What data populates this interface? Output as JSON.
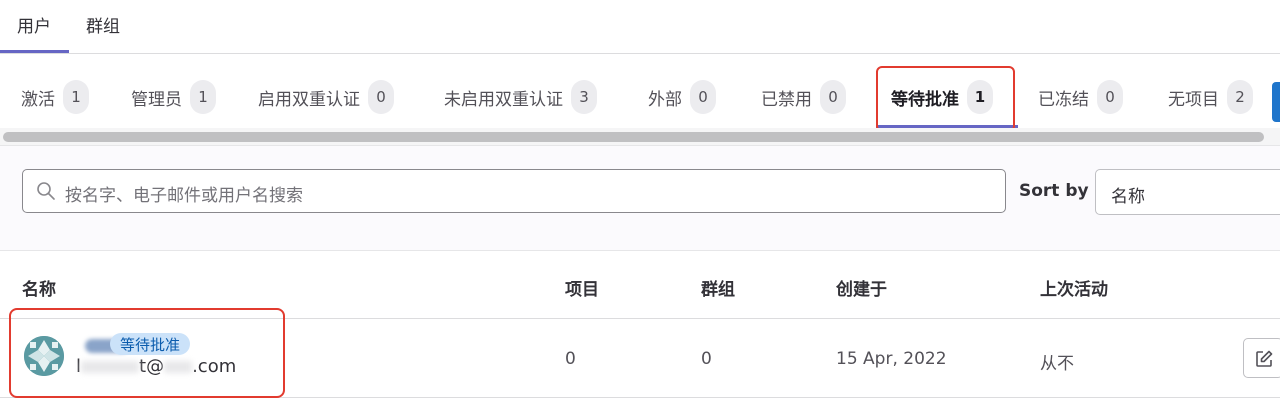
{
  "top_tabs": [
    {
      "label": "用户"
    },
    {
      "label": "群组"
    }
  ],
  "filter_tabs": [
    {
      "label": "激活",
      "count": "1"
    },
    {
      "label": "管理员",
      "count": "1"
    },
    {
      "label": "启用双重认证",
      "count": "0"
    },
    {
      "label": "未启用双重认证",
      "count": "3"
    },
    {
      "label": "外部",
      "count": "0"
    },
    {
      "label": "已禁用",
      "count": "0"
    },
    {
      "label": "等待批准",
      "count": "1"
    },
    {
      "label": "已冻结",
      "count": "0"
    },
    {
      "label": "无项目",
      "count": "2"
    }
  ],
  "active_filter_tab": "等待批准",
  "search": {
    "placeholder": "按名字、电子邮件或用户名搜索"
  },
  "sort": {
    "label": "Sort by",
    "value": "名称"
  },
  "table": {
    "columns": [
      "名称",
      "项目",
      "群组",
      "创建于",
      "上次活动"
    ],
    "rows": [
      {
        "badge": "等待批准",
        "email_prefix": "l",
        "email_mid": "t@",
        "email_suffix": ".com",
        "projects": "0",
        "groups": "0",
        "created": "15 Apr, 2022",
        "last_activity": "从不"
      }
    ]
  },
  "colors": {
    "accent_underline": "#6666c4",
    "highlight_red": "#e23b2f",
    "badge_bg": "#cbe2f9",
    "badge_text": "#0b5cad"
  },
  "icons": {
    "search": "search-icon",
    "edit": "pencil-square-icon"
  }
}
